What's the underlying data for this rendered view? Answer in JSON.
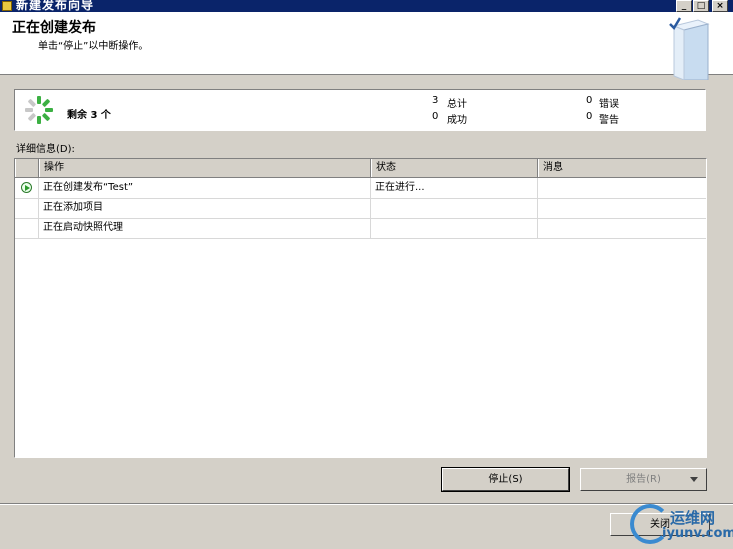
{
  "window": {
    "title": "新建发布向导"
  },
  "header": {
    "title": "正在创建发布",
    "subtitle": "单击“停止”以中断操作。"
  },
  "summary": {
    "remaining": "剩余 3 个",
    "total_count": "3",
    "total_label": "总计",
    "success_count": "0",
    "success_label": "成功",
    "error_count": "0",
    "error_label": "错误",
    "warning_count": "0",
    "warning_label": "警告"
  },
  "details": {
    "label": "详细信息(D):",
    "columns": [
      "操作",
      "状态",
      "消息"
    ],
    "rows": [
      {
        "action": "正在创建发布“Test”",
        "status": "正在进行...",
        "message": "",
        "current": true
      },
      {
        "action": "正在添加项目",
        "status": "",
        "message": "",
        "current": false
      },
      {
        "action": "正在启动快照代理",
        "status": "",
        "message": "",
        "current": false
      }
    ]
  },
  "buttons": {
    "stop": "停止(S)",
    "report": "报告(R)",
    "close": "关闭"
  },
  "watermark": {
    "cn": "运维网",
    "en": "iyunv.com"
  },
  "icons": {
    "app": "wizard-icon",
    "current_row": "play-icon",
    "header": "book-icon"
  },
  "colors": {
    "titlebar": "#0a246a",
    "dialog": "#d4d0c8",
    "progress": "#3cb043"
  }
}
